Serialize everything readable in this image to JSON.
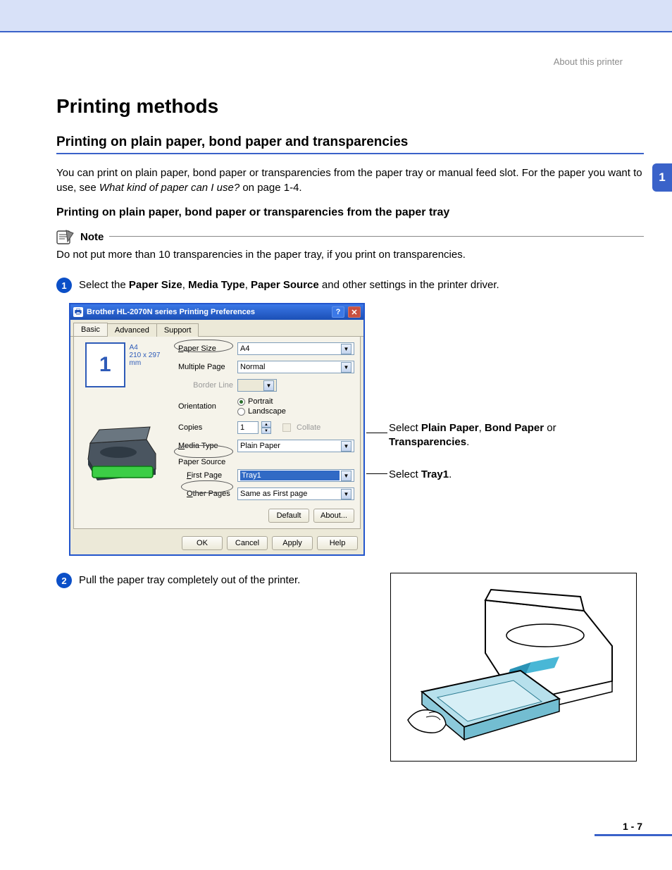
{
  "header": {
    "breadcrumb": "About this printer"
  },
  "page": {
    "title": "Printing methods",
    "h2": "Printing on plain paper, bond paper and transparencies",
    "intro_pre": "You can print on plain paper, bond paper or transparencies from the paper tray or manual feed slot. For the paper you want to use, see ",
    "intro_link": "What kind of paper can I use?",
    "intro_post": " on page 1-4.",
    "h3": "Printing on plain paper, bond paper or transparencies from the paper tray"
  },
  "note": {
    "label": "Note",
    "text": "Do not put more than 10 transparencies in the paper tray, if you print on transparencies."
  },
  "steps": {
    "s1": {
      "num": "1",
      "pre": "Select the ",
      "b1": "Paper Size",
      "sep1": ", ",
      "b2": "Media Type",
      "sep2": ", ",
      "b3": "Paper Source",
      "post": " and other settings in the printer driver."
    },
    "s2": {
      "num": "2",
      "text": "Pull the paper tray completely out of the printer."
    }
  },
  "dialog": {
    "title": "Brother HL-2070N series Printing Preferences",
    "tabs": {
      "basic": "Basic",
      "advanced": "Advanced",
      "support": "Support"
    },
    "preview": {
      "num": "1",
      "size_label": "A4",
      "dims": "210 x 297 mm"
    },
    "labels": {
      "paper_size": "Paper Size",
      "multiple_page": "Multiple Page",
      "border_line": "Border Line",
      "orientation": "Orientation",
      "copies": "Copies",
      "collate": "Collate",
      "media_type": "Media Type",
      "paper_source": "Paper Source",
      "first_page": "First Page",
      "other_pages": "Other Pages"
    },
    "values": {
      "paper_size": "A4",
      "multiple_page": "Normal",
      "portrait": "Portrait",
      "landscape": "Landscape",
      "copies": "1",
      "media_type": "Plain Paper",
      "first_page": "Tray1",
      "other_pages": "Same as First page"
    },
    "buttons": {
      "default": "Default",
      "about": "About...",
      "ok": "OK",
      "cancel": "Cancel",
      "apply": "Apply",
      "help": "Help"
    },
    "winbtn": {
      "help": "?",
      "close": "✕"
    }
  },
  "callouts": {
    "c1_pre": "Select ",
    "c1_b1": "Plain Paper",
    "c1_sep1": ", ",
    "c1_b2": "Bond Paper",
    "c1_sep2": " or ",
    "c1_b3": "Transparencies",
    "c1_post": ".",
    "c2_pre": "Select ",
    "c2_b1": "Tray1",
    "c2_post": "."
  },
  "pagenum": "1 - 7",
  "sidetab": "1"
}
